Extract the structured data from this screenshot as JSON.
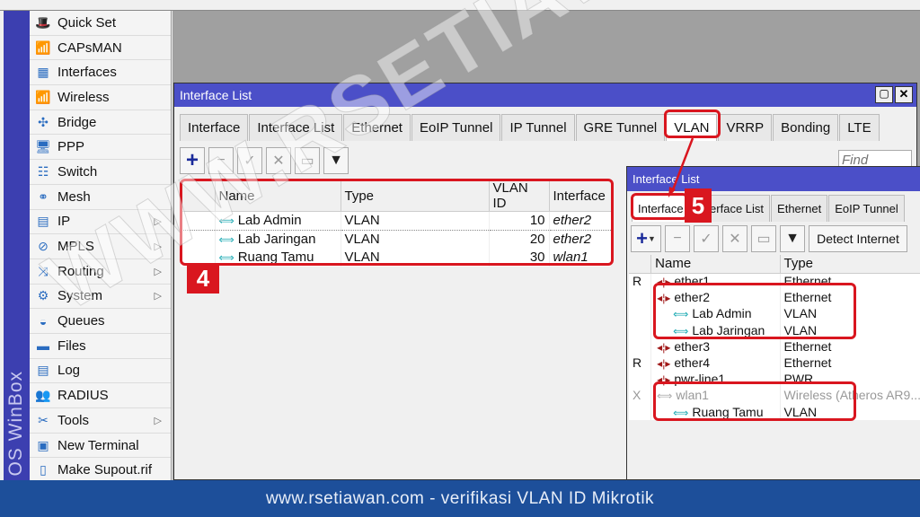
{
  "sidebar": {
    "brand": "OS WinBox",
    "items": [
      {
        "label": "Quick Set",
        "icon": "wand-icon",
        "sub": false
      },
      {
        "label": "CAPsMAN",
        "icon": "antenna-icon",
        "sub": false
      },
      {
        "label": "Interfaces",
        "icon": "nic-icon",
        "sub": false
      },
      {
        "label": "Wireless",
        "icon": "antenna-icon",
        "sub": false
      },
      {
        "label": "Bridge",
        "icon": "bridge-icon",
        "sub": false
      },
      {
        "label": "PPP",
        "icon": "ppp-icon",
        "sub": false
      },
      {
        "label": "Switch",
        "icon": "switch-icon",
        "sub": false
      },
      {
        "label": "Mesh",
        "icon": "mesh-icon",
        "sub": false
      },
      {
        "label": "IP",
        "icon": "ip-icon",
        "sub": true
      },
      {
        "label": "MPLS",
        "icon": "tag-icon",
        "sub": true
      },
      {
        "label": "Routing",
        "icon": "routing-icon",
        "sub": true
      },
      {
        "label": "System",
        "icon": "gear-icon",
        "sub": true
      },
      {
        "label": "Queues",
        "icon": "gauge-icon",
        "sub": false
      },
      {
        "label": "Files",
        "icon": "folder-icon",
        "sub": false
      },
      {
        "label": "Log",
        "icon": "log-icon",
        "sub": false
      },
      {
        "label": "RADIUS",
        "icon": "users-icon",
        "sub": false
      },
      {
        "label": "Tools",
        "icon": "tools-icon",
        "sub": true
      },
      {
        "label": "New Terminal",
        "icon": "terminal-icon",
        "sub": false
      },
      {
        "label": "Make Supout.rif",
        "icon": "file-icon",
        "sub": false
      }
    ]
  },
  "main": {
    "title": "Interface List",
    "tabs": [
      "Interface",
      "Interface List",
      "Ethernet",
      "EoIP Tunnel",
      "IP Tunnel",
      "GRE Tunnel",
      "VLAN",
      "VRRP",
      "Bonding",
      "LTE"
    ],
    "active_tab": "VLAN",
    "find_placeholder": "Find",
    "columns": [
      "Name",
      "Type",
      "VLAN ID",
      "Interface"
    ],
    "rows": [
      {
        "name": "Lab Admin",
        "type": "VLAN",
        "vlan_id": "10",
        "interface": "ether2"
      },
      {
        "name": "Lab Jaringan",
        "type": "VLAN",
        "vlan_id": "20",
        "interface": "ether2"
      },
      {
        "name": "Ruang Tamu",
        "type": "VLAN",
        "vlan_id": "30",
        "interface": "wlan1"
      }
    ]
  },
  "second": {
    "title": "Interface List",
    "tabs": [
      "Interface",
      "Interface List",
      "Ethernet",
      "EoIP Tunnel"
    ],
    "detect_label": "Detect Internet",
    "columns": [
      "Name",
      "Type"
    ],
    "rows": [
      {
        "flag": "R",
        "name": "ether1",
        "type": "Ethernet",
        "kind": "eth",
        "indent": false
      },
      {
        "flag": "",
        "name": "ether2",
        "type": "Ethernet",
        "kind": "eth",
        "indent": false
      },
      {
        "flag": "",
        "name": "Lab Admin",
        "type": "VLAN",
        "kind": "vlan",
        "indent": true
      },
      {
        "flag": "",
        "name": "Lab Jaringan",
        "type": "VLAN",
        "kind": "vlan",
        "indent": true
      },
      {
        "flag": "",
        "name": "ether3",
        "type": "Ethernet",
        "kind": "eth",
        "indent": false
      },
      {
        "flag": "R",
        "name": "ether4",
        "type": "Ethernet",
        "kind": "eth",
        "indent": false
      },
      {
        "flag": "",
        "name": "pwr-line1",
        "type": "PWR",
        "kind": "eth",
        "indent": false
      },
      {
        "flag": "X",
        "name": "wlan1",
        "type": "Wireless (Atheros AR9...",
        "kind": "wlan",
        "indent": false
      },
      {
        "flag": "",
        "name": "Ruang Tamu",
        "type": "VLAN",
        "kind": "vlan",
        "indent": true
      }
    ]
  },
  "annotations": {
    "step4": "4",
    "step5": "5",
    "color": "#d9161f"
  },
  "watermark": "WWW.RSETIAWAN.COM",
  "footer": "www.rsetiawan.com - verifikasi VLAN ID Mikrotik"
}
